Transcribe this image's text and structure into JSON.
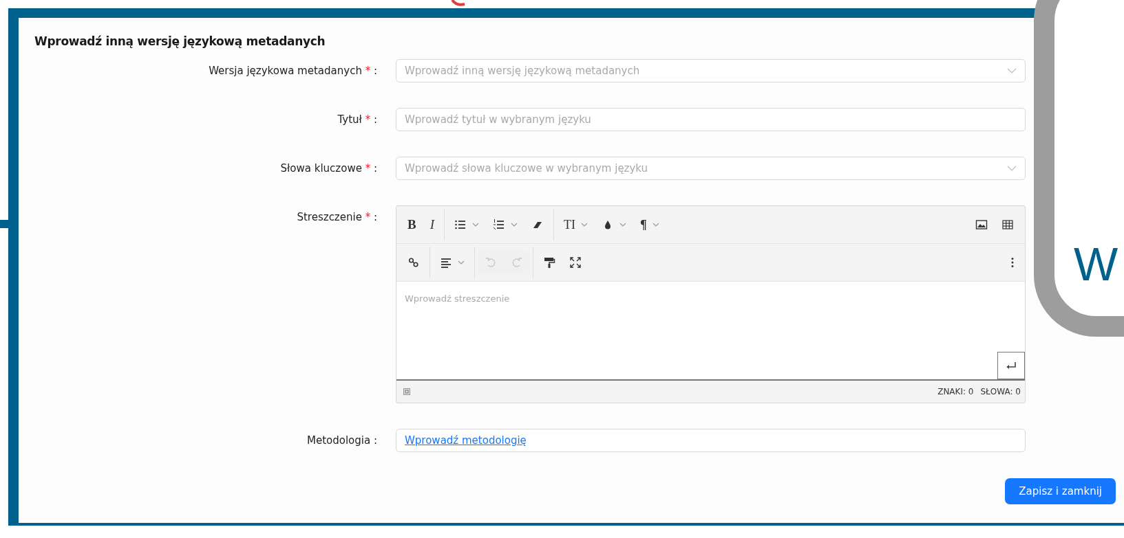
{
  "form": {
    "title": "Wprowadź inną wersję językową metadanych",
    "required_mark": "*",
    "label_suffix": ":",
    "fields": [
      {
        "kind": "select",
        "label": "Wersja językowa metadanych",
        "required": true,
        "placeholder": "Wprowadź inną wersję językową metadanych"
      },
      {
        "kind": "text",
        "label": "Tytuł",
        "required": true,
        "placeholder": "Wprowadź tytuł w wybranym języku"
      },
      {
        "kind": "select",
        "label": "Słowa kluczowe",
        "required": true,
        "placeholder": "Wprowadź słowa kluczowe w wybranym języku"
      },
      {
        "kind": "editor",
        "label": "Streszczenie",
        "required": true,
        "placeholder": "Wprowadź streszczenie",
        "toolbar": [
          [
            {
              "kind": "bold",
              "label": "B",
              "dropdown": false,
              "disabled": false
            },
            {
              "kind": "italic",
              "label": "I",
              "dropdown": false,
              "disabled": false
            },
            {
              "kind": "separator"
            },
            {
              "kind": "bullet-list",
              "dropdown": true,
              "disabled": false
            },
            {
              "kind": "numbered-list",
              "dropdown": true,
              "disabled": false
            },
            {
              "kind": "eraser",
              "dropdown": false,
              "disabled": false
            },
            {
              "kind": "separator"
            },
            {
              "kind": "text-size",
              "label": "TI",
              "dropdown": true,
              "disabled": false
            },
            {
              "kind": "color",
              "dropdown": true,
              "disabled": false
            },
            {
              "kind": "paragraph",
              "label": "¶",
              "dropdown": true,
              "disabled": false
            },
            {
              "kind": "spacer"
            },
            {
              "kind": "image",
              "dropdown": false,
              "disabled": false
            },
            {
              "kind": "table",
              "dropdown": false,
              "disabled": false
            }
          ],
          [
            {
              "kind": "link",
              "dropdown": false,
              "disabled": false
            },
            {
              "kind": "separator"
            },
            {
              "kind": "align",
              "dropdown": true,
              "disabled": false
            },
            {
              "kind": "separator"
            },
            {
              "kind": "undo",
              "dropdown": false,
              "disabled": true
            },
            {
              "kind": "redo",
              "dropdown": false,
              "disabled": true
            },
            {
              "kind": "separator"
            },
            {
              "kind": "format-painter",
              "dropdown": false,
              "disabled": false
            },
            {
              "kind": "fullscreen",
              "dropdown": false,
              "disabled": false
            },
            {
              "kind": "spacer"
            },
            {
              "kind": "more",
              "dropdown": false,
              "disabled": false
            }
          ]
        ],
        "counts": [
          "ZNAKI: 0",
          "SŁOWA: 0"
        ]
      },
      {
        "kind": "link",
        "label": "Metodologia",
        "required": false,
        "link": "Wprowadź metodologię"
      }
    ]
  },
  "button": "Zapisz i zamknij",
  "decoration": {
    "letter": "W"
  }
}
